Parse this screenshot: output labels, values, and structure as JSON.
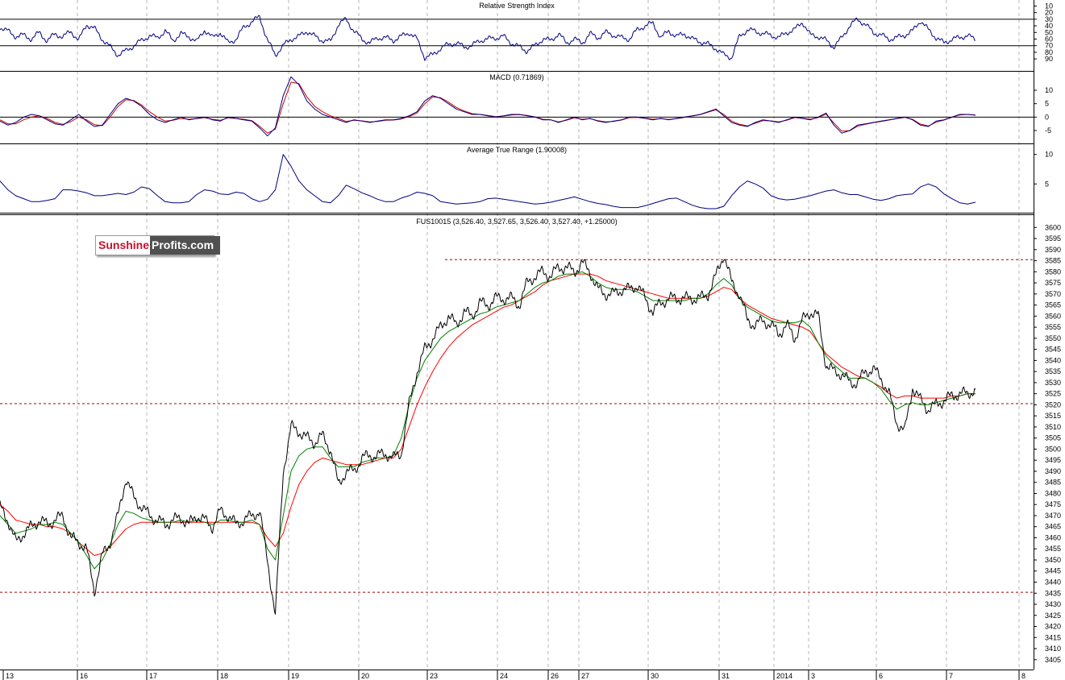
{
  "brand": {
    "part1": "Sunshine",
    "part2": "Profits.com"
  },
  "colors": {
    "price": "#000000",
    "ma_fast": "#008000",
    "ma_slow": "#ff0000",
    "indicator": "#000080",
    "macd_signal": "#cc0000",
    "level": "#a00000",
    "grid": "#b4b4b4"
  },
  "chart_data": {
    "type": "line",
    "x_ticks": [
      "13",
      "16",
      "17",
      "18",
      "19",
      "20",
      "23",
      "24",
      "26",
      "27",
      "30",
      "31",
      "2014",
      "3",
      "6",
      "7",
      "8"
    ],
    "panels": [
      {
        "id": "rsi",
        "title": "Relative Strength Index",
        "y_ticks": [
          "90",
          "80",
          "70",
          "60",
          "50",
          "40",
          "30",
          "20",
          "10"
        ],
        "ylim": [
          0,
          100
        ],
        "ref_lines": [
          70,
          30
        ],
        "series": [
          {
            "values": [
              42,
              48,
              56,
              54,
              60,
              50,
              63,
              52,
              57,
              48,
              62,
              38,
              44,
              60,
              72,
              84,
              78,
              70,
              62,
              55,
              58,
              48,
              62,
              52,
              56,
              64,
              46,
              58,
              50,
              66,
              60,
              42,
              34,
              26,
              62,
              84,
              70,
              60,
              56,
              48,
              56,
              62,
              64,
              38,
              30,
              48,
              60,
              66,
              58,
              58,
              62,
              56,
              50,
              60,
              88,
              84,
              74,
              68,
              66,
              72,
              70,
              62,
              60,
              58,
              56,
              66,
              72,
              78,
              70,
              60,
              62,
              52,
              66,
              60,
              66,
              52,
              58,
              50,
              54,
              58,
              60,
              46,
              40,
              36,
              58,
              48,
              56,
              52,
              60,
              64,
              68,
              74,
              84,
              88,
              56,
              46,
              48,
              52,
              54,
              58,
              50,
              46,
              34,
              54,
              56,
              62,
              72,
              58,
              40,
              30,
              38,
              50,
              54,
              60,
              58,
              54,
              48,
              32,
              46,
              58,
              66,
              60,
              58,
              54,
              62
            ]
          }
        ]
      },
      {
        "id": "macd",
        "title": "MACD (0.71869)",
        "y_ticks": [
          "10",
          "5",
          "0",
          "-5"
        ],
        "ylim": [
          -8,
          17
        ],
        "ref_lines": [
          0
        ],
        "series": [
          {
            "name": "MACD",
            "values": [
              -1.5,
              -3,
              -2,
              0,
              1,
              0.5,
              -1,
              -2.5,
              -3,
              -1,
              1,
              -1.5,
              -3.5,
              -3,
              1,
              5,
              7,
              6,
              4,
              1,
              -1,
              -2,
              -1,
              0,
              -1,
              -0.5,
              0,
              -1,
              -1.5,
              0,
              -0.5,
              -1,
              -1.5,
              -4,
              -7,
              -4,
              8,
              15,
              12,
              6,
              3,
              1,
              0,
              -1,
              -2,
              -1,
              -1.5,
              -2,
              -1.5,
              -1,
              -1,
              -0.5,
              0.5,
              2,
              6,
              8,
              7,
              5,
              3,
              2,
              1,
              1,
              0.5,
              0,
              0.5,
              1,
              1,
              0.5,
              0,
              -1,
              -1,
              -2,
              -1,
              0,
              -1,
              -0.5,
              -1.5,
              -2,
              -1.5,
              -1,
              0,
              0,
              -0.5,
              -1,
              -0.5,
              -1,
              -0.5,
              0,
              0.5,
              1,
              2,
              3,
              0.5,
              -2,
              -3,
              -3.5,
              -2,
              -1,
              -1.5,
              -2,
              -1,
              0,
              -0.5,
              -1,
              0,
              1.5,
              -3,
              -6,
              -5,
              -3,
              -2.5,
              -2,
              -1.5,
              -1,
              -0.5,
              0,
              -1,
              -3,
              -3.5,
              -1.5,
              -1,
              0,
              1,
              1,
              0.7
            ]
          },
          {
            "name": "Signal",
            "values": [
              -1,
              -2.5,
              -2.5,
              -1,
              0,
              0.5,
              -0.5,
              -2,
              -2.7,
              -1.7,
              0,
              -1,
              -2.8,
              -3.2,
              0,
              4,
              6.5,
              6.2,
              4.5,
              2,
              0,
              -1.5,
              -1.2,
              -0.5,
              -0.8,
              -0.6,
              -0.2,
              -0.8,
              -1.2,
              -0.3,
              -0.5,
              -0.8,
              -1.3,
              -3.4,
              -6,
              -4.5,
              5,
              13,
              12.5,
              7.5,
              4,
              2,
              0.5,
              -0.5,
              -1.6,
              -1.2,
              -1.4,
              -1.8,
              -1.6,
              -1.2,
              -1.1,
              -0.7,
              0.2,
              1.5,
              5,
              7.5,
              7.2,
              5.6,
              3.6,
              2.3,
              1.3,
              1,
              0.6,
              0.2,
              0.4,
              0.8,
              0.9,
              0.6,
              0.1,
              -0.8,
              -1,
              -1.8,
              -1.2,
              -0.3,
              -0.8,
              -0.6,
              -1.3,
              -1.8,
              -1.6,
              -1.1,
              -0.2,
              -0.1,
              -0.4,
              -0.8,
              -0.6,
              -0.9,
              -0.6,
              -0.1,
              0.4,
              0.9,
              1.8,
              2.7,
              1,
              -1.5,
              -2.7,
              -3.3,
              -2.3,
              -1.3,
              -1.4,
              -1.8,
              -1.2,
              -0.2,
              -0.4,
              -0.8,
              -0.2,
              1.1,
              -2.2,
              -5.2,
              -5.1,
              -3.4,
              -2.7,
              -2.1,
              -1.6,
              -1.1,
              -0.6,
              -0.1,
              -0.8,
              -2.6,
              -3.3,
              -1.9,
              -1.1,
              -0.1,
              0.8,
              1,
              0.8
            ]
          }
        ]
      },
      {
        "id": "atr",
        "title": "Average True Range (1.90008)",
        "y_ticks": [
          "10",
          "5"
        ],
        "ylim": [
          0,
          11.5
        ],
        "ref_lines": [],
        "series": [
          {
            "values": [
              5.5,
              4,
              3,
              2.5,
              2,
              2,
              2.2,
              2.5,
              4,
              4,
              3.8,
              3.5,
              3,
              3,
              3.2,
              3.4,
              3.2,
              3.6,
              4.5,
              4.2,
              3,
              2,
              1.8,
              1.8,
              2,
              3.2,
              4,
              3.8,
              3.3,
              3.2,
              3.6,
              3.4,
              2.5,
              2,
              2.4,
              4,
              10,
              8,
              5.5,
              4,
              3,
              2,
              1.8,
              3,
              4.8,
              4.2,
              3.5,
              3,
              2.4,
              2,
              2,
              2.6,
              3,
              3.6,
              3.4,
              3,
              2,
              1.8,
              1.6,
              1.7,
              1.8,
              2,
              2.5,
              2.6,
              2.4,
              2.2,
              2,
              1.8,
              1.6,
              1.7,
              1.9,
              2.2,
              2.5,
              2.8,
              2.4,
              2,
              1.7,
              1.5,
              1.2,
              1,
              1,
              1,
              1.3,
              1.7,
              2.1,
              2.5,
              2.6,
              2,
              1.4,
              1,
              0.8,
              0.8,
              1.2,
              3,
              4.5,
              5.5,
              5,
              4.3,
              3,
              2.5,
              2.3,
              2.4,
              2.7,
              3,
              3.4,
              3.8,
              4,
              3.5,
              3.2,
              3.2,
              2.8,
              2.4,
              2.2,
              2.5,
              3,
              3.2,
              3.3,
              4.5,
              5,
              4.5,
              3.3,
              2.5,
              1.8,
              1.6,
              1.9
            ]
          }
        ]
      },
      {
        "id": "price",
        "title": "FUS10015 (3,526.40, 3,527.65, 3,526.40, 3,527.40, +1.25000)",
        "y_ticks": [
          "3600",
          "3595",
          "3590",
          "3585",
          "3580",
          "3575",
          "3570",
          "3565",
          "3560",
          "3555",
          "3550",
          "3545",
          "3540",
          "3535",
          "3530",
          "3525",
          "3520",
          "3515",
          "3510",
          "3505",
          "3500",
          "3495",
          "3490",
          "3485",
          "3480",
          "3475",
          "3470",
          "3465",
          "3460",
          "3455",
          "3450",
          "3445",
          "3440",
          "3435",
          "3430",
          "3425",
          "3420",
          "3415",
          "3410",
          "3405"
        ],
        "ylim": [
          3400.6,
          3603.3
        ],
        "ref_lines": [
          3585.5,
          3520.5,
          3435.4
        ],
        "series": [
          {
            "name": "price",
            "values": [
              3474,
              3468,
              3458,
              3462,
              3465,
              3468,
              3466,
              3468,
              3470,
              3460,
              3458,
              3455,
              3436,
              3452,
              3458,
              3470,
              3487,
              3478,
              3474,
              3470,
              3468,
              3466,
              3468,
              3469,
              3466,
              3470,
              3468,
              3465,
              3472,
              3470,
              3466,
              3468,
              3470,
              3472,
              3450,
              3425,
              3490,
              3510,
              3508,
              3505,
              3503,
              3506,
              3500,
              3484,
              3490,
              3490,
              3496,
              3497,
              3497,
              3498,
              3496,
              3498,
              3520,
              3535,
              3545,
              3550,
              3555,
              3560,
              3556,
              3562,
              3560,
              3566,
              3565,
              3568,
              3568,
              3568,
              3565,
              3575,
              3578,
              3580,
              3578,
              3582,
              3582,
              3580,
              3584,
              3580,
              3572,
              3570,
              3570,
              3572,
              3572,
              3574,
              3568,
              3562,
              3566,
              3568,
              3568,
              3568,
              3568,
              3568,
              3570,
              3578,
              3588,
              3575,
              3570,
              3558,
              3556,
              3558,
              3556,
              3552,
              3556,
              3550,
              3558,
              3562,
              3560,
              3538,
              3535,
              3534,
              3530,
              3530,
              3535,
              3536,
              3532,
              3525,
              3512,
              3508,
              3528,
              3522,
              3518,
              3520,
              3522,
              3524,
              3525,
              3525,
              3527
            ]
          },
          {
            "name": "fast MA",
            "values": [
              3470,
              3466,
              3462,
              3463,
              3464,
              3466,
              3466,
              3467,
              3466,
              3462,
              3458,
              3452,
              3446,
              3450,
              3457,
              3466,
              3472,
              3471,
              3469,
              3468,
              3467,
              3467,
              3467,
              3468,
              3467,
              3468,
              3467,
              3466,
              3468,
              3468,
              3467,
              3467,
              3468,
              3466,
              3455,
              3450,
              3470,
              3490,
              3497,
              3500,
              3501,
              3501,
              3496,
              3492,
              3492,
              3492,
              3494,
              3495,
              3496,
              3496,
              3497,
              3505,
              3520,
              3532,
              3540,
              3545,
              3550,
              3553,
              3555,
              3557,
              3559,
              3561,
              3562,
              3564,
              3565,
              3566,
              3567,
              3570,
              3573,
              3575,
              3576,
              3578,
              3579,
              3579,
              3580,
              3578,
              3575,
              3573,
              3572,
              3572,
              3572,
              3571,
              3569,
              3567,
              3567,
              3567,
              3567,
              3567,
              3568,
              3568,
              3570,
              3574,
              3577,
              3574,
              3568,
              3564,
              3562,
              3560,
              3558,
              3557,
              3557,
              3557,
              3558,
              3555,
              3548,
              3542,
              3538,
              3535,
              3532,
              3532,
              3532,
              3530,
              3527,
              3522,
              3518,
              3520,
              3521,
              3520,
              3520,
              3521,
              3522,
              3523,
              3524,
              3525,
              3525
            ]
          },
          {
            "name": "slow MA",
            "values": [
              3475,
              3472,
              3468,
              3467,
              3466,
              3466,
              3465,
              3465,
              3464,
              3462,
              3458,
              3455,
              3452,
              3453,
              3456,
              3460,
              3464,
              3466,
              3467,
              3467,
              3467,
              3467,
              3467,
              3467,
              3467,
              3467,
              3467,
              3467,
              3467,
              3467,
              3467,
              3467,
              3467,
              3466,
              3460,
              3456,
              3462,
              3474,
              3484,
              3490,
              3494,
              3496,
              3495,
              3494,
              3493,
              3493,
              3493,
              3494,
              3495,
              3496,
              3496,
              3500,
              3510,
              3520,
              3528,
              3535,
              3541,
              3546,
              3550,
              3553,
              3556,
              3558,
              3560,
              3562,
              3564,
              3565,
              3567,
              3569,
              3571,
              3574,
              3576,
              3577,
              3578,
              3579,
              3579,
              3579,
              3578,
              3576,
              3575,
              3574,
              3573,
              3572,
              3571,
              3570,
              3569,
              3568,
              3568,
              3568,
              3568,
              3568,
              3569,
              3571,
              3573,
              3572,
              3568,
              3565,
              3563,
              3561,
              3559,
              3558,
              3557,
              3556,
              3555,
              3553,
              3548,
              3543,
              3540,
              3537,
              3535,
              3533,
              3532,
              3530,
              3528,
              3525,
              3523,
              3524,
              3524,
              3523,
              3523,
              3523,
              3523,
              3524,
              3524,
              3525,
              3525
            ]
          }
        ]
      }
    ]
  }
}
